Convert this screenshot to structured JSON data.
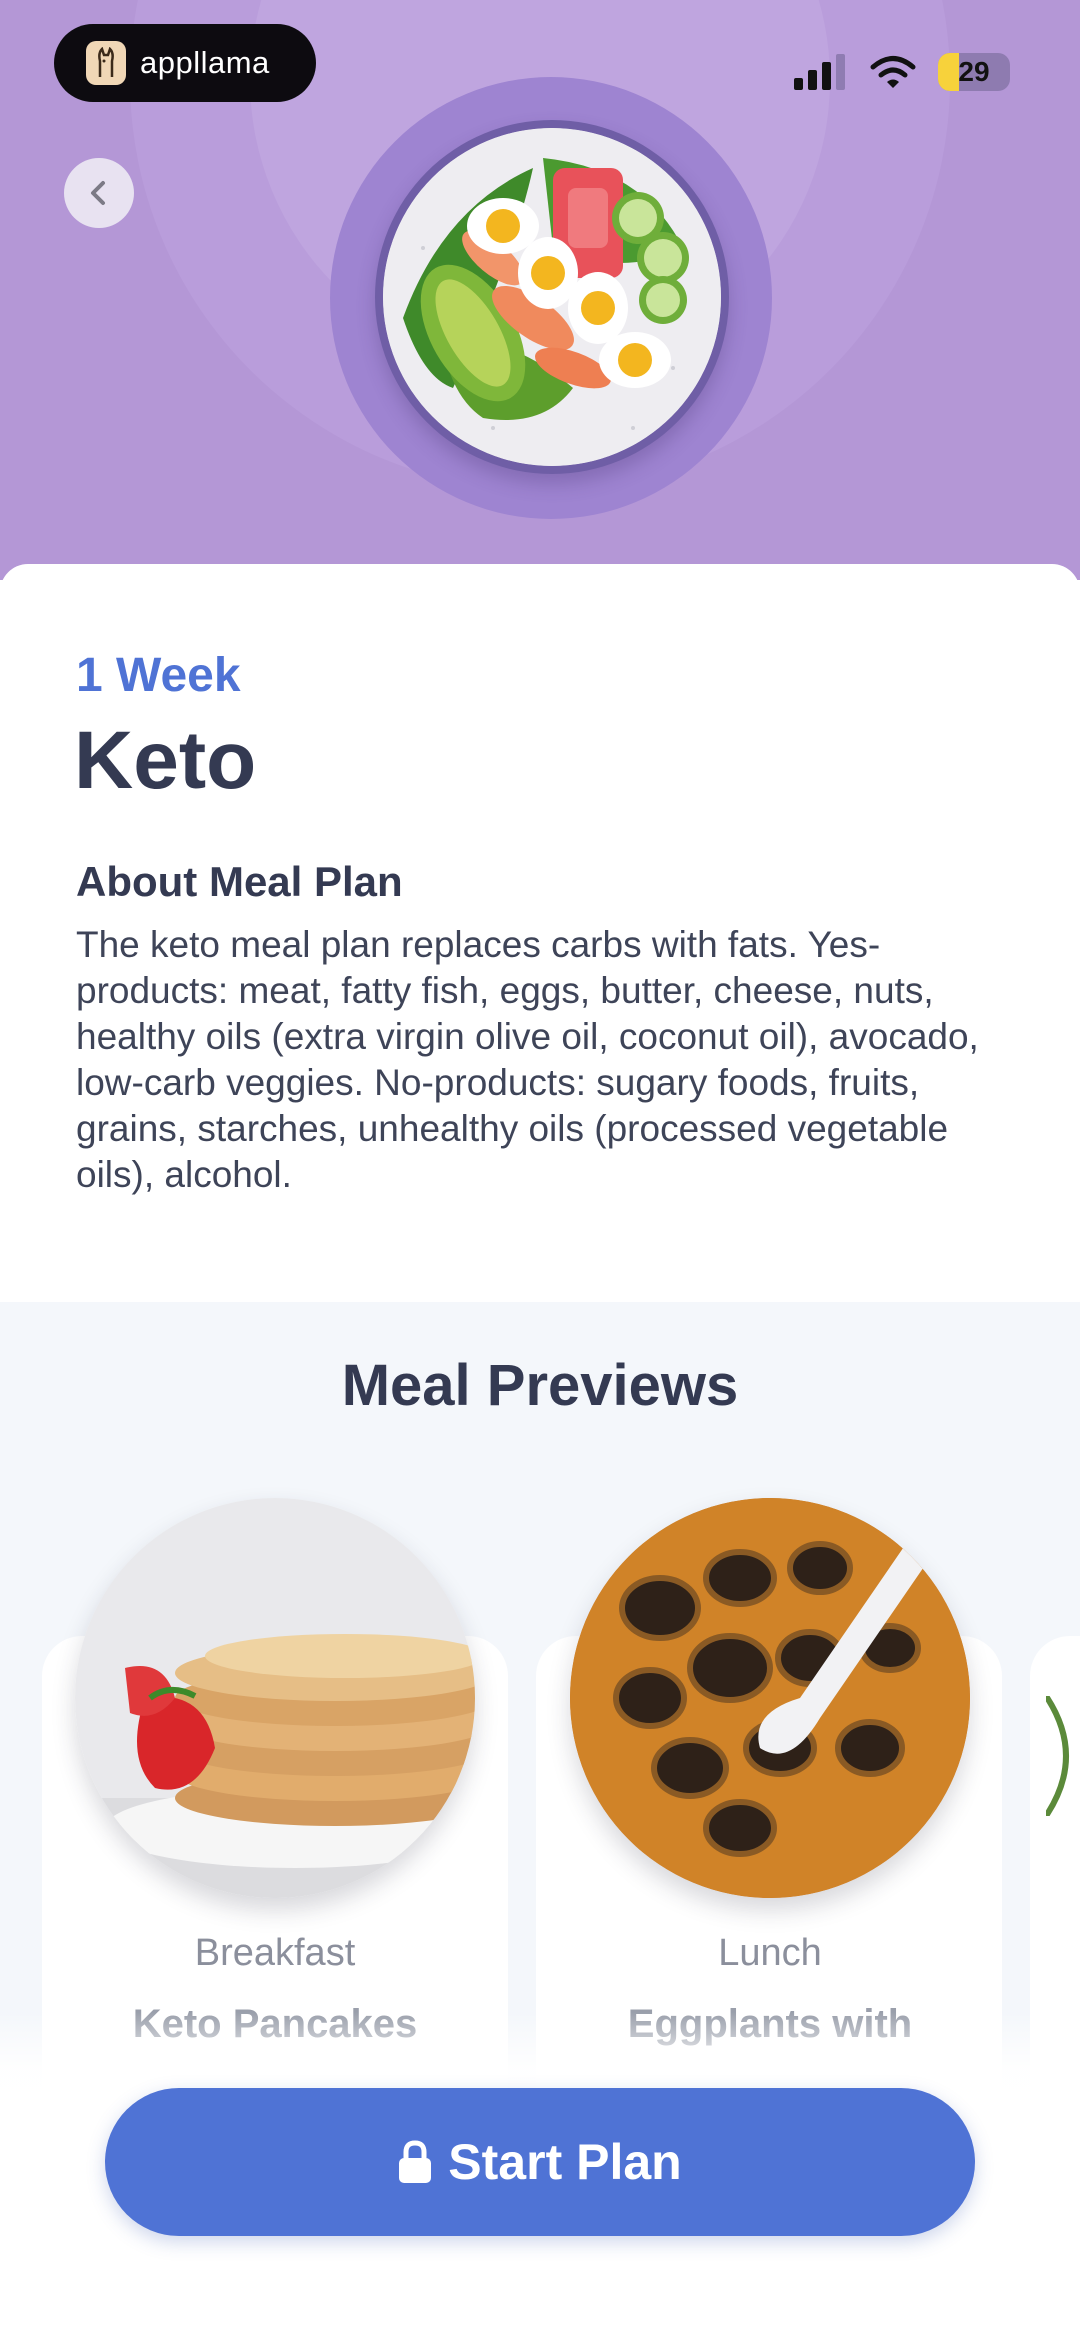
{
  "status_bar": {
    "brand": "appllama",
    "battery": "29",
    "battery_level": 0.29
  },
  "header": {
    "back_label": "Back"
  },
  "plan": {
    "duration": "1 Week",
    "title": "Keto",
    "about_heading": "About Meal Plan",
    "about_text": "The keto meal plan replaces carbs with fats. Yes-products: meat, fatty fish, eggs, butter, cheese, nuts, healthy oils (extra virgin olive oil, coconut oil), avocado, low-carb veggies. No-products: sugary foods, fruits, grains, starches, unhealthy oils (processed vegetable oils), alcohol."
  },
  "previews": {
    "title": "Meal Previews",
    "meals": [
      {
        "type": "Breakfast",
        "name": "Keto Pancakes"
      },
      {
        "type": "Lunch",
        "name": "Eggplants with"
      }
    ]
  },
  "cta": {
    "label": "Start Plan",
    "icon": "lock-icon"
  },
  "colors": {
    "hero": "#b497d6",
    "accent": "#4f73d5",
    "heading": "#343a52"
  }
}
